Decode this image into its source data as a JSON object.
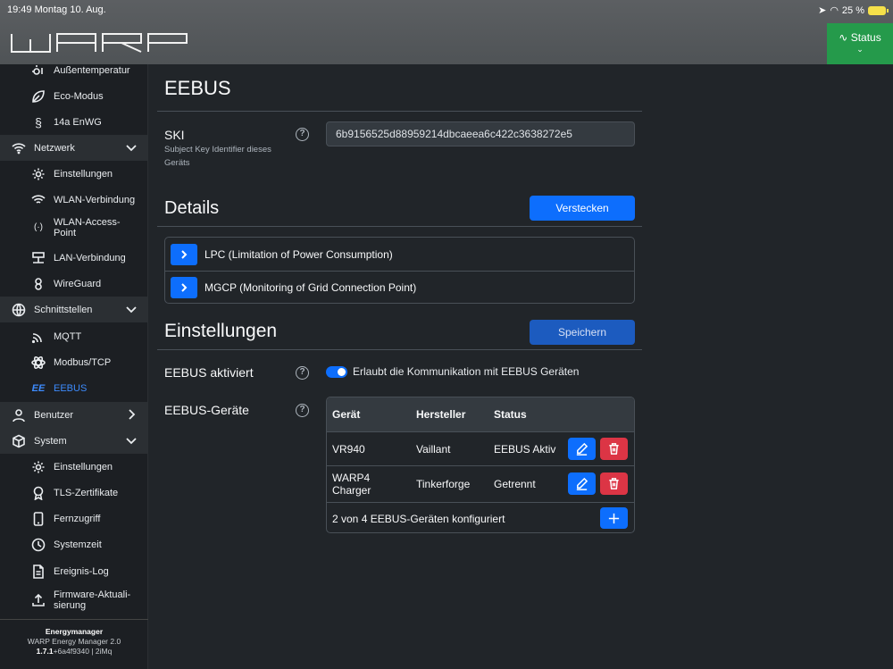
{
  "ios": {
    "time_date": "19:49  Montag 10. Aug.",
    "battery": "25 %"
  },
  "header": {
    "status_label": "Status"
  },
  "sidebar": {
    "items": [
      {
        "label": "Außentemperatur"
      },
      {
        "label": "Eco-Modus"
      },
      {
        "label": "14a EnWG"
      },
      {
        "label": "Netzwerk"
      },
      {
        "label": "Einstellungen"
      },
      {
        "label": "WLAN-Verbindung"
      },
      {
        "label": "WLAN-Access-Point"
      },
      {
        "label": "LAN-Verbindung"
      },
      {
        "label": "WireGuard"
      },
      {
        "label": "Schnittstellen"
      },
      {
        "label": "MQTT"
      },
      {
        "label": "Modbus/TCP"
      },
      {
        "label": "EEBUS"
      },
      {
        "label": "Benutzer"
      },
      {
        "label": "System"
      },
      {
        "label": "Einstellungen"
      },
      {
        "label": "TLS-Zertifikate"
      },
      {
        "label": "Fernzugriff"
      },
      {
        "label": "Systemzeit"
      },
      {
        "label": "Ereignis-Log"
      },
      {
        "label": "Firmware-Aktuali-sierung"
      }
    ],
    "footer": {
      "name": "Energymanager",
      "device": "WARP Energy Manager 2.0",
      "version": "1.7.1",
      "build": "+6a4f9340 | 2iMq"
    }
  },
  "main": {
    "title": "EEBUS",
    "ski": {
      "label": "SKI",
      "desc": "Subject Key Identifier dieses Geräts",
      "value": "6b9156525d88959214dbcaeea6c422c3638272e5",
      "help": "?"
    },
    "details": {
      "title": "Details",
      "hide_button": "Verstecken",
      "items": [
        {
          "label": "LPC (Limitation of Power Consumption)"
        },
        {
          "label": "MGCP (Monitoring of Grid Connection Point)"
        }
      ]
    },
    "settings": {
      "title": "Einstellungen",
      "save_button": "Speichern",
      "enabled_label": "EEBUS aktiviert",
      "enabled_desc": "Erlaubt die Kommunikation mit EEBUS Geräten",
      "enabled": true,
      "devices_label": "EEBUS-Geräte",
      "help": "?"
    },
    "devices": {
      "headers": [
        "Gerät",
        "Hersteller",
        "Status"
      ],
      "rows": [
        {
          "device": "VR940",
          "vendor": "Vaillant",
          "status": "EEBUS Aktiv"
        },
        {
          "device": "WARP4 Charger",
          "vendor": "Tinkerforge",
          "status": "Getrennt"
        }
      ],
      "footer": "2 von 4 EEBUS-Geräten konfiguriert"
    }
  },
  "colors": {
    "accent": "#0d6efd",
    "danger": "#dc3545",
    "status_green": "#259a4b"
  }
}
